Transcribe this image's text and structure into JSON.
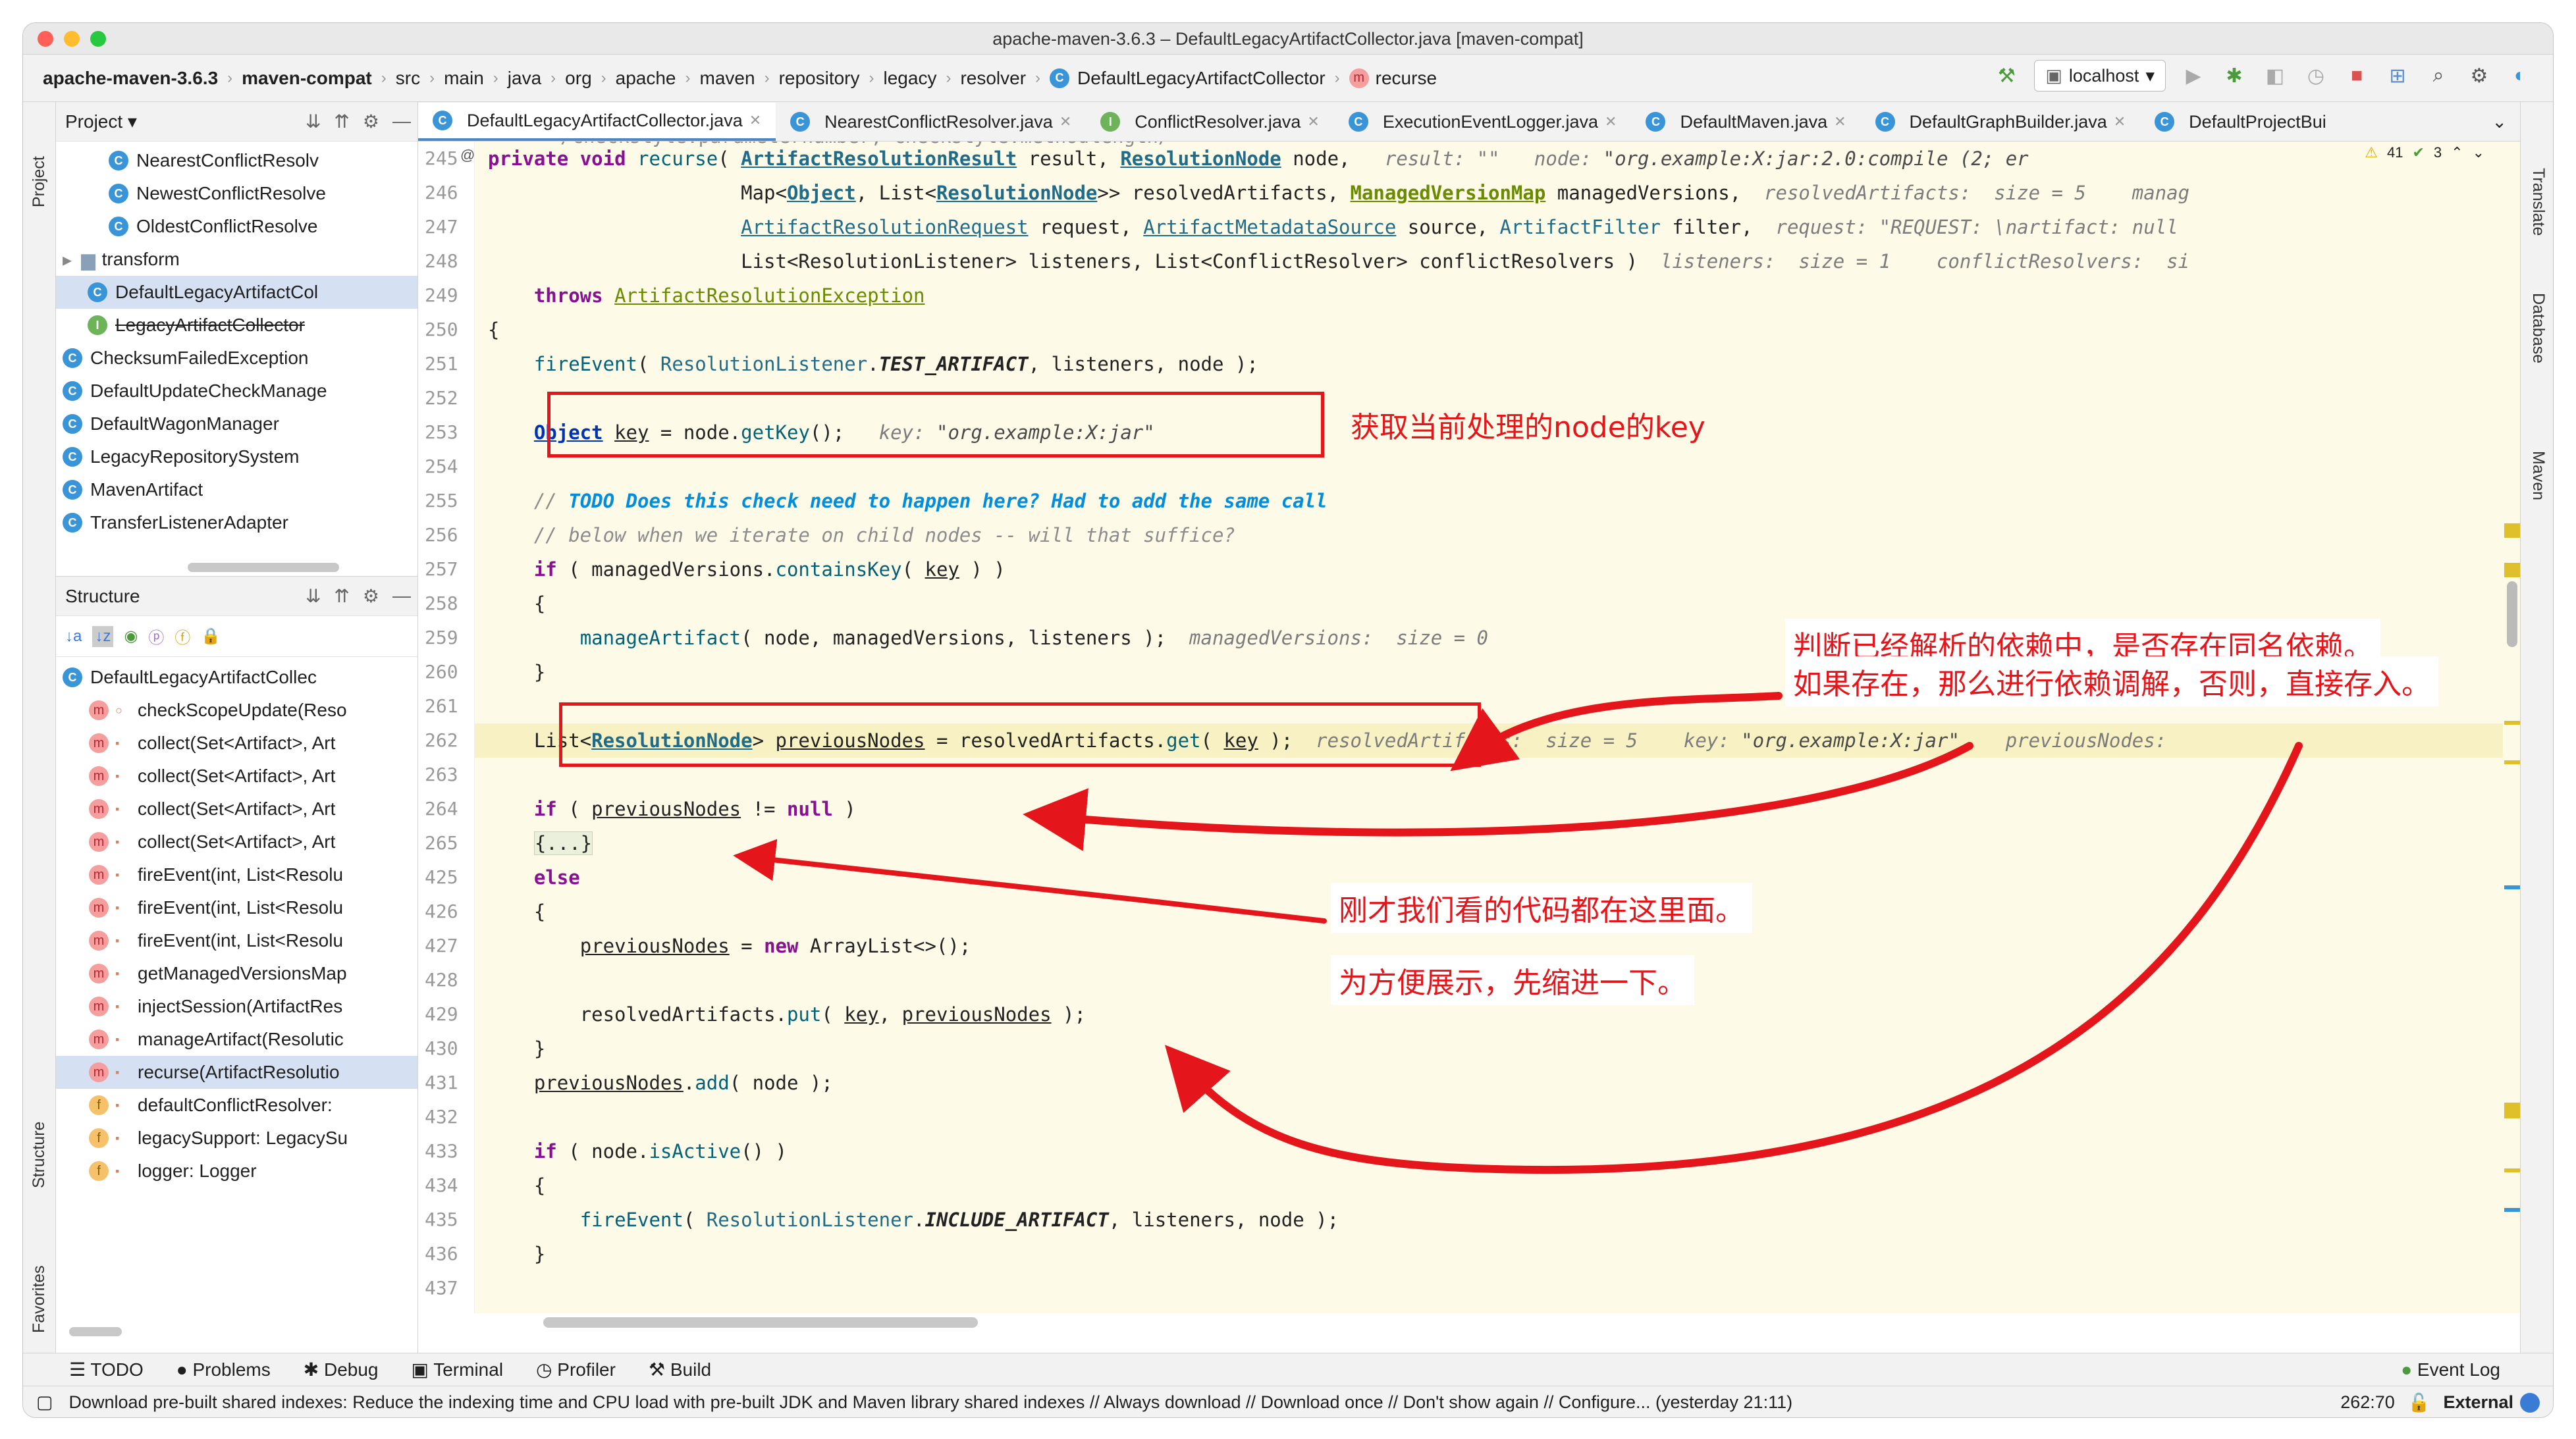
{
  "window": {
    "title": "apache-maven-3.6.3 – DefaultLegacyArtifactCollector.java [maven-compat]"
  },
  "breadcrumb": [
    "apache-maven-3.6.3",
    "maven-compat",
    "src",
    "main",
    "java",
    "org",
    "apache",
    "maven",
    "repository",
    "legacy",
    "resolver",
    "DefaultLegacyArtifactCollector",
    "recurse"
  ],
  "toolbar": {
    "run_config": "localhost"
  },
  "left_strip": {
    "project": "Project",
    "structure": "Structure",
    "favorites": "Favorites"
  },
  "right_strip": {
    "translate": "Translate",
    "database": "Database",
    "maven": "Maven"
  },
  "project_panel": {
    "title": "Project",
    "items": [
      {
        "label": "NearestConflictResolv",
        "kind": "class"
      },
      {
        "label": "NewestConflictResolve",
        "kind": "class"
      },
      {
        "label": "OldestConflictResolve",
        "kind": "class"
      },
      {
        "label": "transform",
        "kind": "folder"
      },
      {
        "label": "DefaultLegacyArtifactCol",
        "kind": "class"
      },
      {
        "label": "LegacyArtifactCollector",
        "kind": "interface"
      },
      {
        "label": "ChecksumFailedException",
        "kind": "class"
      },
      {
        "label": "DefaultUpdateCheckManage",
        "kind": "class"
      },
      {
        "label": "DefaultWagonManager",
        "kind": "class"
      },
      {
        "label": "LegacyRepositorySystem",
        "kind": "class"
      },
      {
        "label": "MavenArtifact",
        "kind": "class"
      },
      {
        "label": "TransferListenerAdapter",
        "kind": "class"
      }
    ]
  },
  "structure_panel": {
    "title": "Structure",
    "root": "DefaultLegacyArtifactCollec",
    "members": [
      {
        "label": "checkScopeUpdate(Reso",
        "kind": "m"
      },
      {
        "label": "collect(Set<Artifact>, Art",
        "kind": "m"
      },
      {
        "label": "collect(Set<Artifact>, Art",
        "kind": "m"
      },
      {
        "label": "collect(Set<Artifact>, Art",
        "kind": "m"
      },
      {
        "label": "collect(Set<Artifact>, Art",
        "kind": "m"
      },
      {
        "label": "fireEvent(int, List<Resolu",
        "kind": "m"
      },
      {
        "label": "fireEvent(int, List<Resolu",
        "kind": "m"
      },
      {
        "label": "fireEvent(int, List<Resolu",
        "kind": "m"
      },
      {
        "label": "getManagedVersionsMap",
        "kind": "m"
      },
      {
        "label": "injectSession(ArtifactRes",
        "kind": "m"
      },
      {
        "label": "manageArtifact(Resolutic",
        "kind": "m"
      },
      {
        "label": "recurse(ArtifactResolutio",
        "kind": "m"
      },
      {
        "label": "defaultConflictResolver:",
        "kind": "f"
      },
      {
        "label": "legacySupport: LegacySu",
        "kind": "f"
      },
      {
        "label": "logger: Logger",
        "kind": "f"
      }
    ]
  },
  "tabs": [
    {
      "label": "DefaultLegacyArtifactCollector.java",
      "active": true
    },
    {
      "label": "NearestConflictResolver.java"
    },
    {
      "label": "ConflictResolver.java"
    },
    {
      "label": "ExecutionEventLogger.java"
    },
    {
      "label": "DefaultMaven.java"
    },
    {
      "label": "DefaultGraphBuilder.java"
    },
    {
      "label": "DefaultProjectBui"
    }
  ],
  "inspection": {
    "warnings": "41",
    "ok": "3"
  },
  "line_numbers": [
    "245",
    "246",
    "247",
    "248",
    "249",
    "250",
    "251",
    "252",
    "253",
    "254",
    "255",
    "256",
    "257",
    "258",
    "259",
    "260",
    "261",
    "262",
    "263",
    "264",
    "265",
    "425",
    "426",
    "427",
    "428",
    "429",
    "430",
    "431",
    "432",
    "433",
    "434",
    "435",
    "436",
    "437"
  ],
  "code_top_fragment": "/checkstyle:parameternumber, checkstyle:methodlength/",
  "annotations": {
    "get_key": "获取当前处理的node的key",
    "check_resolved_1": "判断已经解析的依赖中，是否存在同名依赖。",
    "check_resolved_2": "如果存在，那么进行依赖调解，否则，直接存入。",
    "folded_1": "刚才我们看的代码都在这里面。",
    "folded_2": "为方便展示，先缩进一下。"
  },
  "bottom_tools": [
    "TODO",
    "Problems",
    "Debug",
    "Terminal",
    "Profiler",
    "Build"
  ],
  "event_log": "Event Log",
  "status": {
    "message": "Download pre-built shared indexes: Reduce the indexing time and CPU load with pre-built JDK and Maven library shared indexes // Always download // Download once // Don't show again // Configure... (yesterday 21:11)",
    "position": "262:70",
    "mode": "External"
  },
  "colors": {
    "annotation": "#e4161b",
    "accent": "#4a86c8"
  }
}
